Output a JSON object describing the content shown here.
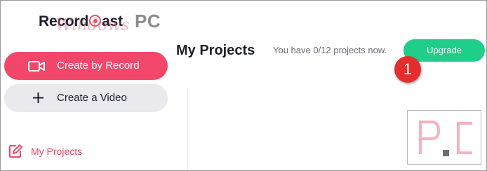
{
  "logo": {
    "brand_text": "Record",
    "brand_text_tail": "ast",
    "watermark_script": "Windows",
    "watermark_pc": "PC"
  },
  "sidebar": {
    "create_by_record_label": "Create by Record",
    "create_video_label": "Create a Video",
    "nav": [
      {
        "label": "My Projects",
        "icon": "edit-icon",
        "active": true
      }
    ]
  },
  "header": {
    "title": "My Projects",
    "quota_text": "You have 0/12 projects now.",
    "upgrade_label": "Upgrade",
    "step_badge": "1"
  },
  "watermark": {
    "text": "P.C"
  },
  "colors": {
    "accent": "#f2476b",
    "upgrade": "#1fce88",
    "badge": "#e42d2d",
    "secondary_button": "#e9e9ee"
  }
}
